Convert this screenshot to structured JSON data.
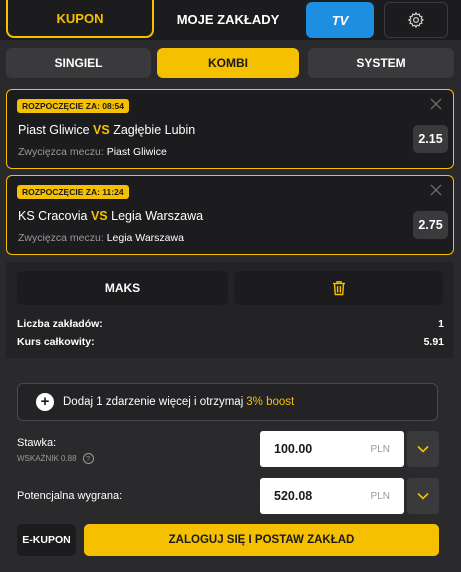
{
  "tabs": {
    "kupon": "KUPON",
    "moje": "MOJE ZAKŁADY",
    "tv": "TV",
    "settings_icon": "gear-icon"
  },
  "bet_types": {
    "singiel": "SINGIEL",
    "kombi": "KOMBI",
    "system": "SYSTEM",
    "active": "KOMBI"
  },
  "events": [
    {
      "badge": "ROZPOCZĘCIE ZA: 08:54",
      "home": "Piast Gliwice",
      "vs": "VS",
      "away": "Zagłębie Lubin",
      "market": "Zwycięzca meczu:",
      "selection": "Piast Gliwice",
      "odds": "2.15"
    },
    {
      "badge": "ROZPOCZĘCIE ZA: 11:24",
      "home": "KS Cracovia",
      "vs": "VS",
      "away": "Legia Warszawa",
      "market": "Zwycięzca meczu:",
      "selection": "Legia Warszawa",
      "odds": "2.75"
    }
  ],
  "summary": {
    "maks_label": "MAKS",
    "trash_icon": "trash-icon",
    "bets_count_label": "Liczba zakładów:",
    "bets_count_value": "1",
    "total_odds_label": "Kurs całkowity:",
    "total_odds_value": "5.91"
  },
  "boost": {
    "text": "Dodaj 1 zdarzenie więcej i otrzymaj",
    "highlight": "3% boost"
  },
  "stake": {
    "label": "Stawka:",
    "indicator": "WSKAŹNIK 0.88",
    "info_symbol": "?",
    "value": "100.00",
    "currency": "PLN"
  },
  "potential": {
    "label": "Potencjalna wygrana:",
    "value": "520.08",
    "currency": "PLN"
  },
  "actions": {
    "ekupon": "E-KUPON",
    "place": "ZALOGUJ SIĘ I POSTAW ZAKŁAD"
  },
  "colors": {
    "accent": "#f5c000",
    "tv": "#1e8fe0",
    "background": "#2a2a2c"
  }
}
